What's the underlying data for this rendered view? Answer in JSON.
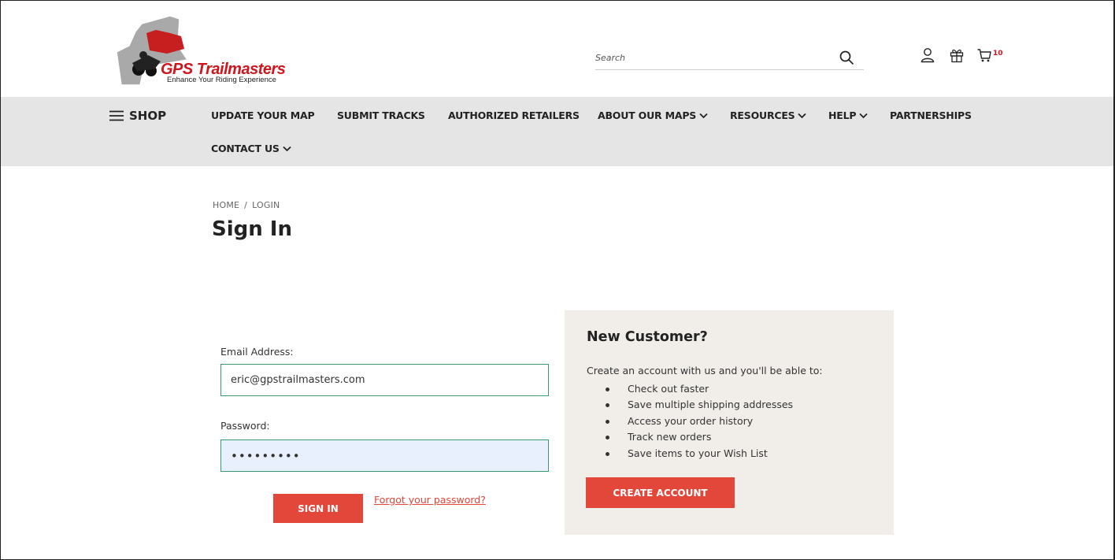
{
  "brand": {
    "name": "GPS Trailmasters",
    "tagline": "Enhance Your Riding Experience"
  },
  "header": {
    "search_placeholder": "Search",
    "cart_count": "10",
    "icons": [
      "account-icon",
      "gift-icon",
      "cart-icon",
      "search-icon"
    ]
  },
  "nav": {
    "shop_label": "SHOP",
    "items": [
      {
        "label": "UPDATE YOUR MAP",
        "dropdown": false
      },
      {
        "label": "SUBMIT TRACKS",
        "dropdown": false
      },
      {
        "label": "AUTHORIZED RETAILERS",
        "dropdown": false
      },
      {
        "label": "ABOUT OUR MAPS",
        "dropdown": true
      },
      {
        "label": "RESOURCES",
        "dropdown": true
      },
      {
        "label": "HELP",
        "dropdown": true
      },
      {
        "label": "PARTNERSHIPS",
        "dropdown": false
      },
      {
        "label": "CONTACT US",
        "dropdown": true
      }
    ]
  },
  "breadcrumb": {
    "items": [
      "HOME",
      "LOGIN"
    ],
    "separator": "/"
  },
  "page": {
    "title": "Sign In"
  },
  "login": {
    "email_label": "Email Address:",
    "email_value": "eric@gpstrailmasters.com",
    "password_label": "Password:",
    "password_value": "•••••••••",
    "sign_in_label": "SIGN IN",
    "forgot_label": "Forgot your password?"
  },
  "new_customer": {
    "title": "New Customer?",
    "intro": "Create an account with us and you'll be able to:",
    "benefits": [
      "Check out faster",
      "Save multiple shipping addresses",
      "Access your order history",
      "Track new orders",
      "Save items to your Wish List"
    ],
    "create_label": "CREATE ACCOUNT"
  },
  "colors": {
    "accent": "#e3473a",
    "brand_red": "#d0161d",
    "nav_bg": "#e5e5e5",
    "panel_bg": "#f1eeea",
    "field_border": "#3a9a6a",
    "autofill_bg": "#e8f0fe"
  }
}
